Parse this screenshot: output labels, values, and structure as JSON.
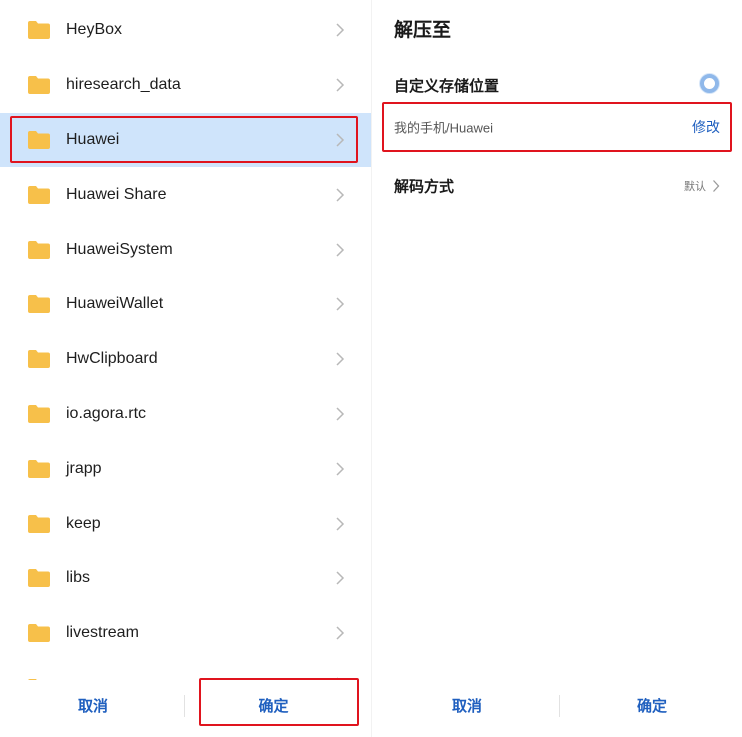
{
  "folder_picker": {
    "folders": [
      {
        "name": "HeyBox"
      },
      {
        "name": "hiresearch_data"
      },
      {
        "name": "Huawei",
        "selected": true
      },
      {
        "name": "Huawei Share"
      },
      {
        "name": "HuaweiSystem"
      },
      {
        "name": "HuaweiWallet"
      },
      {
        "name": "HwClipboard"
      },
      {
        "name": "io.agora.rtc"
      },
      {
        "name": "jrapp"
      },
      {
        "name": "keep"
      },
      {
        "name": "libs"
      },
      {
        "name": "livestream"
      }
    ],
    "cancel_label": "取消",
    "confirm_label": "确定",
    "folder_color": "#f7c04a",
    "selected_bg": "#cfe4fb"
  },
  "extract_dialog": {
    "title": "解压至",
    "custom_location_label": "自定义存储位置",
    "path": "我的手机/Huawei",
    "edit_label": "修改",
    "decode_label": "解码方式",
    "decode_value": "默认",
    "cancel_label": "取消",
    "confirm_label": "确定",
    "accent_color": "#1f5fbf",
    "highlight_color": "#e0141e"
  }
}
